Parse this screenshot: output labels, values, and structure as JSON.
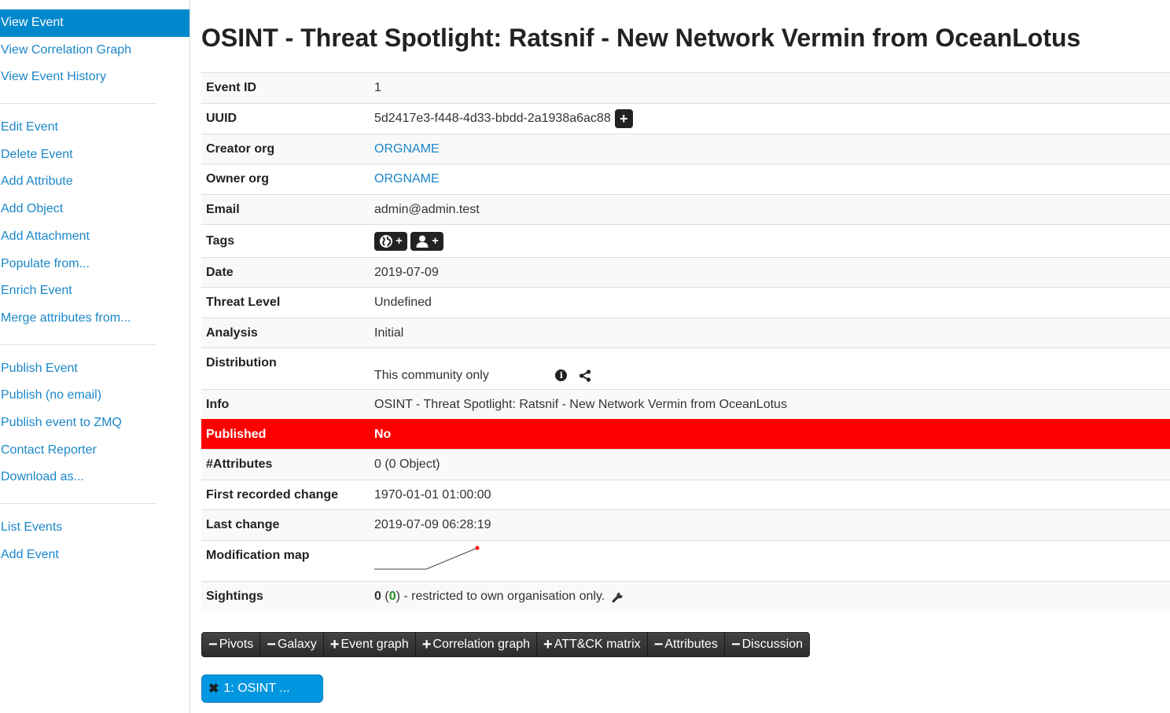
{
  "sidebar": {
    "groups": [
      [
        "View Event",
        "View Correlation Graph",
        "View Event History"
      ],
      [
        "Edit Event",
        "Delete Event",
        "Add Attribute",
        "Add Object",
        "Add Attachment",
        "Populate from...",
        "Enrich Event",
        "Merge attributes from..."
      ],
      [
        "Publish Event",
        "Publish (no email)",
        "Publish event to ZMQ",
        "Contact Reporter",
        "Download as..."
      ],
      [
        "List Events",
        "Add Event"
      ]
    ],
    "active": "View Event"
  },
  "event": {
    "title": "OSINT - Threat Spotlight: Ratsnif - New Network Vermin from OceanLotus",
    "rows": {
      "event_id": {
        "label": "Event ID",
        "value": "1"
      },
      "uuid": {
        "label": "UUID",
        "value": "5d2417e3-f448-4d33-bbdd-2a1938a6ac88",
        "button": "+"
      },
      "creator_org": {
        "label": "Creator org",
        "value": "ORGNAME"
      },
      "owner_org": {
        "label": "Owner org",
        "value": "ORGNAME"
      },
      "email": {
        "label": "Email",
        "value": "admin@admin.test"
      },
      "tags": {
        "label": "Tags",
        "add_global": "+",
        "add_local": "+"
      },
      "date": {
        "label": "Date",
        "value": "2019-07-09"
      },
      "threat_level": {
        "label": "Threat Level",
        "value": "Undefined"
      },
      "analysis": {
        "label": "Analysis",
        "value": "Initial"
      },
      "distribution": {
        "label": "Distribution",
        "value": "This community only",
        "info_glyph": "i"
      },
      "info": {
        "label": "Info",
        "value": "OSINT - Threat Spotlight: Ratsnif - New Network Vermin from OceanLotus"
      },
      "published": {
        "label": "Published",
        "value": "No"
      },
      "attributes": {
        "label": "#Attributes",
        "value": "0 (0 Object)"
      },
      "first_change": {
        "label": "First recorded change",
        "value": "1970-01-01 01:00:00"
      },
      "last_change": {
        "label": "Last change",
        "value": "2019-07-09 06:28:19"
      },
      "modification_map": {
        "label": "Modification map"
      },
      "sightings": {
        "label": "Sightings",
        "count": "0",
        "open": " (",
        "green_count": "0",
        "suffix": ") - restricted to own organisation only."
      }
    }
  },
  "tabs": [
    {
      "sign": "−",
      "label": "Pivots"
    },
    {
      "sign": "−",
      "label": "Galaxy"
    },
    {
      "sign": "+",
      "label": "Event graph"
    },
    {
      "sign": "+",
      "label": "Correlation graph"
    },
    {
      "sign": "+",
      "label": "ATT&CK matrix"
    },
    {
      "sign": "−",
      "label": "Attributes"
    },
    {
      "sign": "−",
      "label": "Discussion"
    }
  ],
  "pivot_chip": {
    "label": "1: OSINT ...",
    "close": "✖"
  },
  "colors": {
    "accent": "#0088cc",
    "link": "#1b87c9",
    "published_bg": "#ff0000",
    "tab_bg": "#333333"
  }
}
